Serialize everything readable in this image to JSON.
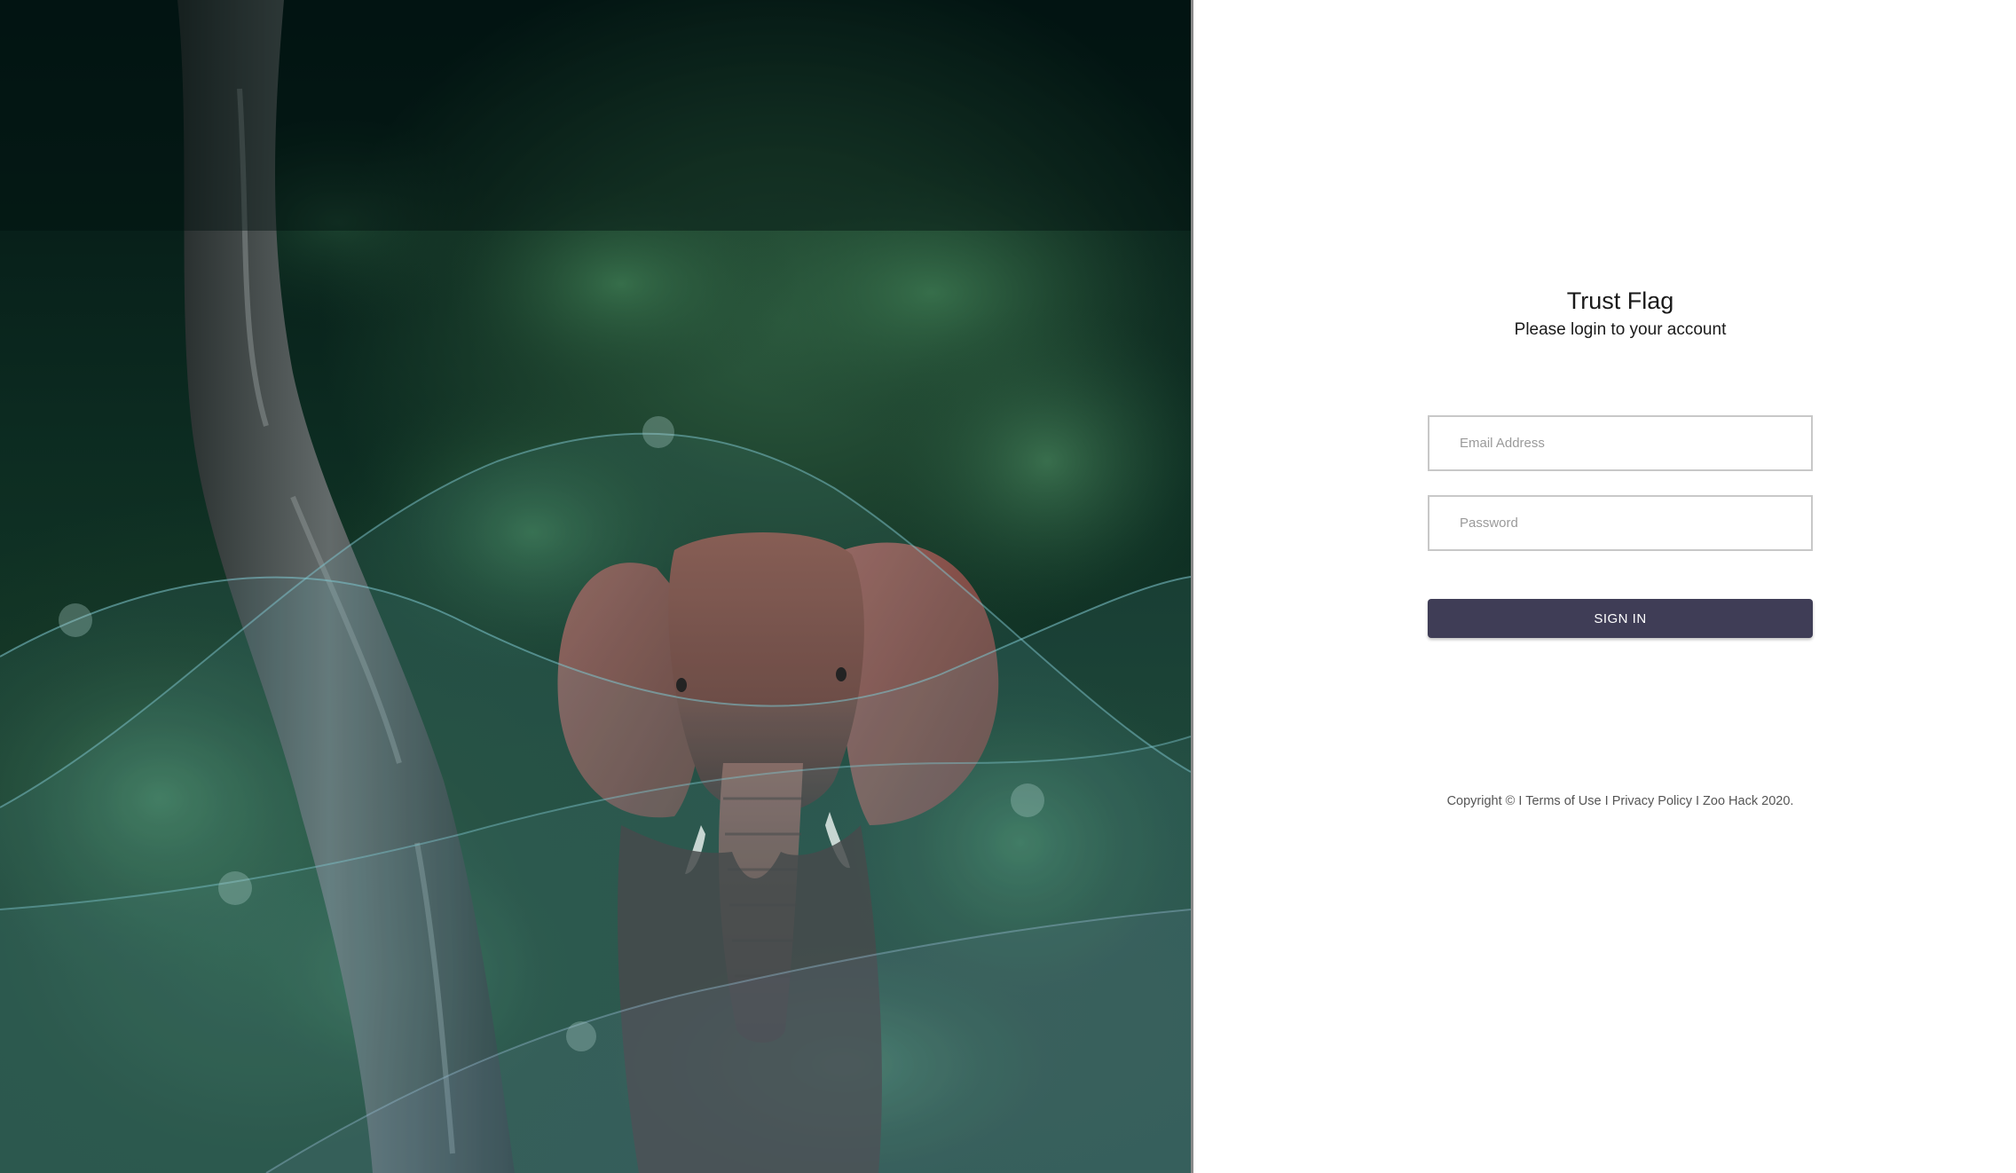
{
  "app": {
    "title": "Trust Flag",
    "subtitle": "Please login to your account"
  },
  "hero": {
    "image_subject": "elephant-in-forest-photo",
    "overlay_color": "#6fb6c0"
  },
  "form": {
    "email_placeholder": "Email Address",
    "email_value": "",
    "password_placeholder": "Password",
    "password_value": "",
    "signin_label": "SIGN IN"
  },
  "footer": {
    "copyright": "Copyright ©",
    "sep1": "I",
    "terms_label": "Terms of Use",
    "sep2": "I",
    "privacy_label": "Privacy Policy",
    "sep3": "I",
    "suffix": "Zoo Hack 2020."
  },
  "colors": {
    "button_bg": "#3f3d56",
    "input_border": "#c8c8c8",
    "text": "#1a1a1a"
  }
}
